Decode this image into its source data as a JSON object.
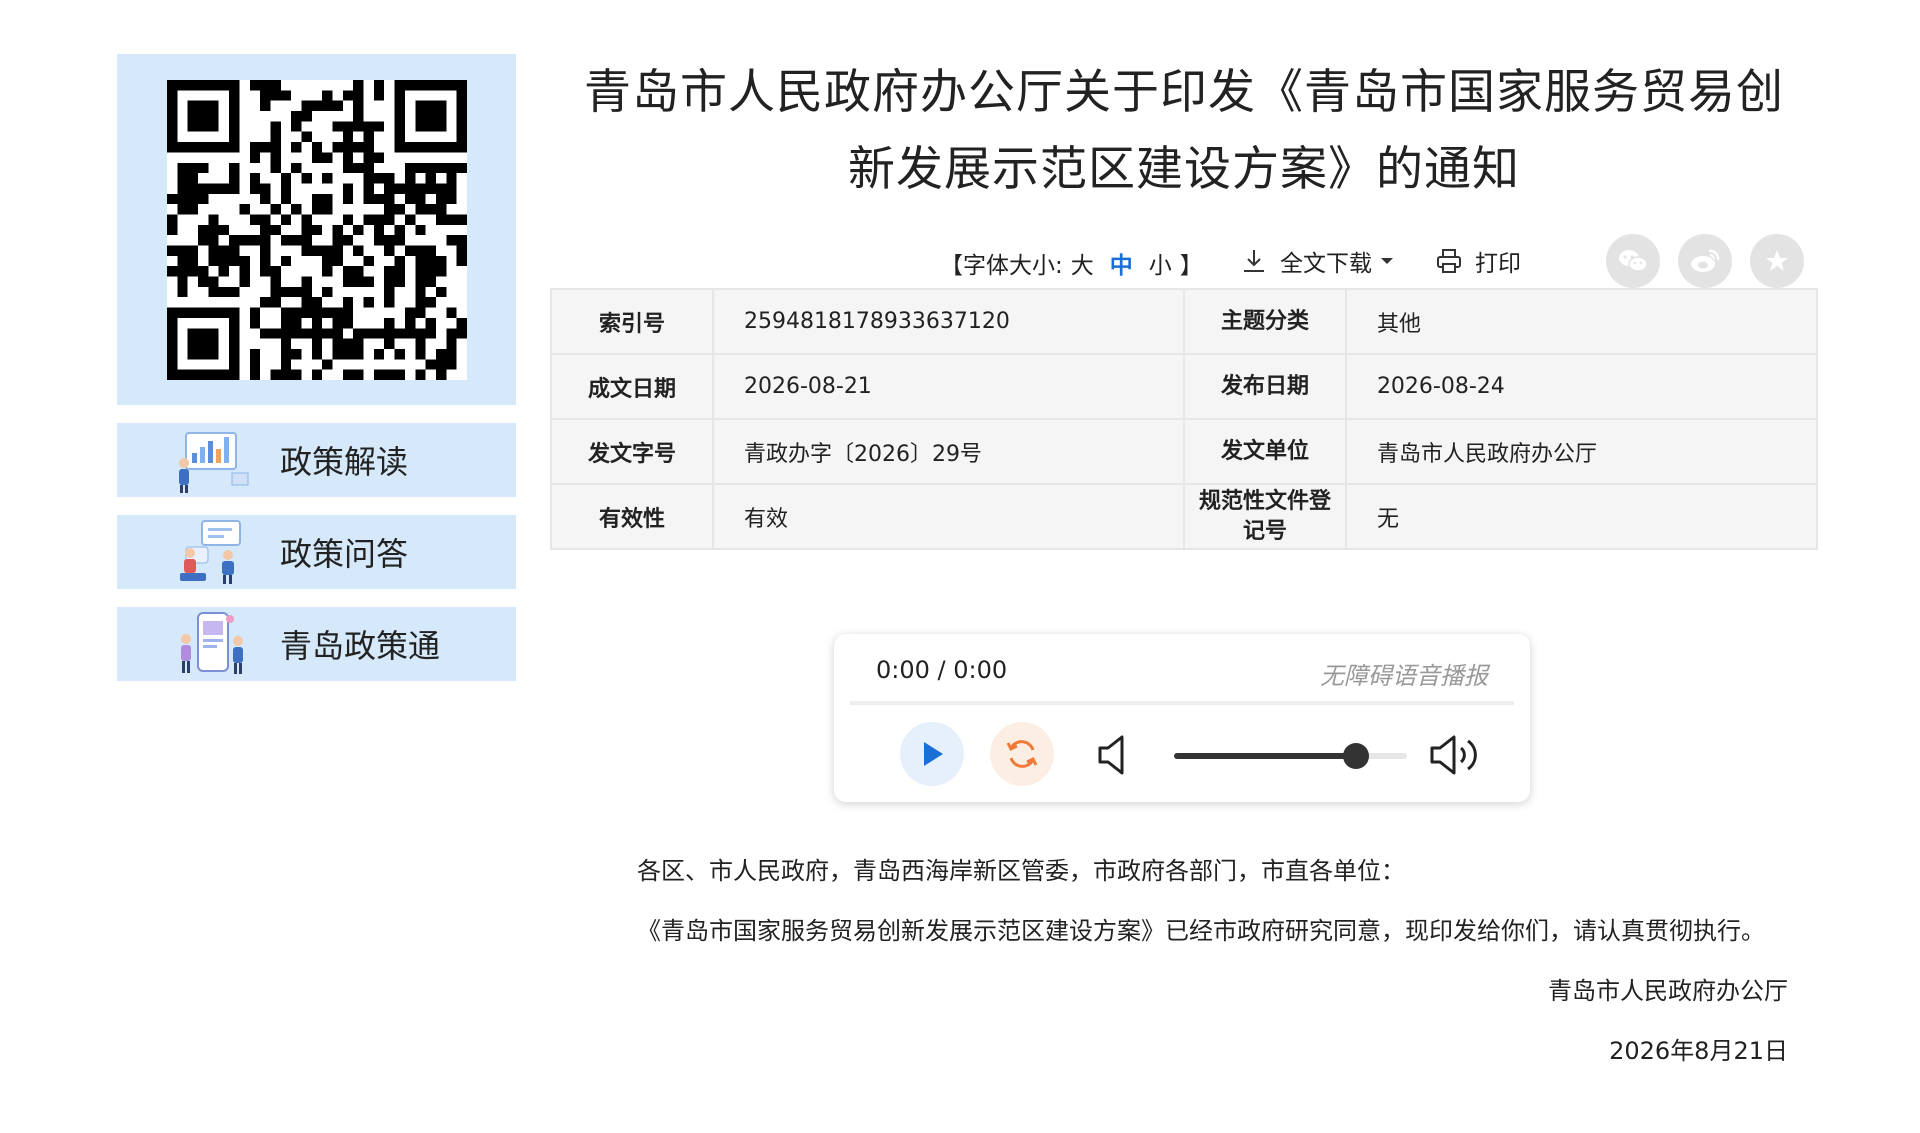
{
  "sidebar": {
    "qr_label": "QR code",
    "links": [
      {
        "label": "政策解读"
      },
      {
        "label": "政策问答"
      },
      {
        "label": "青岛政策通"
      }
    ]
  },
  "document": {
    "title_line1": "青岛市人民政府办公厅关于印发《青岛市国家服务贸易创",
    "title_line2": "新发展示范区建设方案》的通知"
  },
  "toolbar": {
    "font_size_prefix": "【字体大小:",
    "font_large": "大",
    "font_medium": "中",
    "font_small": "小",
    "font_size_suffix": "】",
    "download_label": "全文下载",
    "print_label": "打印",
    "active_color": "#1a6fd6"
  },
  "meta": {
    "rows": [
      {
        "k1": "索引号",
        "v1": "2594818178933637120",
        "k2": "主题分类",
        "v2": "其他"
      },
      {
        "k1": "成文日期",
        "v1": "2026-08-21",
        "k2": "发布日期",
        "v2": "2026-08-24"
      },
      {
        "k1": "发文字号",
        "v1": "青政办字〔2026〕29号",
        "k2": "发文单位",
        "v2": "青岛市人民政府办公厅"
      },
      {
        "k1": "有效性",
        "v1": "有效",
        "k2": "规范性文件登记号",
        "v2": "无"
      }
    ]
  },
  "player": {
    "time": "0:00 / 0:00",
    "accessibility_label": "无障碍语音播报",
    "volume_level": 0.78,
    "play_color": "#1a6fd6",
    "replay_color": "#f07a3a"
  },
  "body": {
    "salutation": "各区、市人民政府，青岛西海岸新区管委，市政府各部门，市直各单位：",
    "paragraph": "《青岛市国家服务贸易创新发展示范区建设方案》已经市政府研究同意，现印发给你们，请认真贯彻执行。",
    "signature": "青岛市人民政府办公厅",
    "date": "2026年8月21日"
  }
}
